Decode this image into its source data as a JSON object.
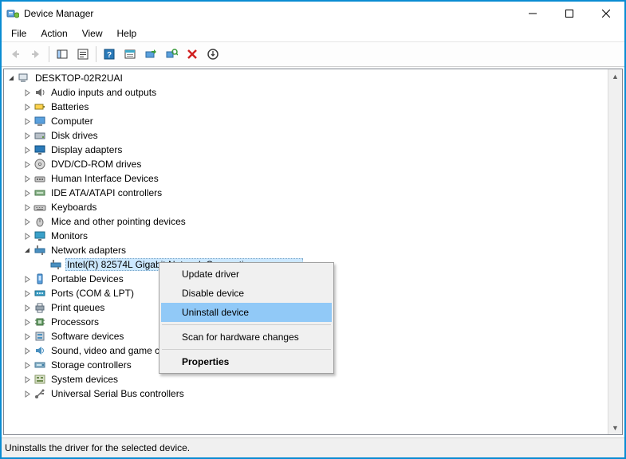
{
  "window": {
    "title": "Device Manager"
  },
  "menubar": {
    "file": "File",
    "action": "Action",
    "view": "View",
    "help": "Help"
  },
  "toolbar": {
    "back": "Back",
    "forward": "Forward",
    "show_hide_console": "Show/Hide Console Tree",
    "properties": "Properties",
    "help": "Help",
    "show_hidden": "Show hidden devices",
    "update_driver": "Update device driver",
    "scan_hardware": "Scan for hardware changes",
    "uninstall": "Uninstall device",
    "add_legacy": "Add legacy hardware"
  },
  "tree": {
    "root": {
      "label": "DESKTOP-02R2UAI",
      "expanded": true
    },
    "categories": [
      {
        "id": "audio",
        "label": "Audio inputs and outputs",
        "icon": "audio-icon",
        "expanded": false
      },
      {
        "id": "batteries",
        "label": "Batteries",
        "icon": "battery-icon",
        "expanded": false
      },
      {
        "id": "computer",
        "label": "Computer",
        "icon": "computer-icon",
        "expanded": false
      },
      {
        "id": "disk",
        "label": "Disk drives",
        "icon": "disk-icon",
        "expanded": false
      },
      {
        "id": "display",
        "label": "Display adapters",
        "icon": "display-icon",
        "expanded": false
      },
      {
        "id": "dvd",
        "label": "DVD/CD-ROM drives",
        "icon": "dvd-icon",
        "expanded": false
      },
      {
        "id": "hid",
        "label": "Human Interface Devices",
        "icon": "hid-icon",
        "expanded": false
      },
      {
        "id": "ide",
        "label": "IDE ATA/ATAPI controllers",
        "icon": "ide-icon",
        "expanded": false
      },
      {
        "id": "keyboards",
        "label": "Keyboards",
        "icon": "keyboard-icon",
        "expanded": false
      },
      {
        "id": "mice",
        "label": "Mice and other pointing devices",
        "icon": "mouse-icon",
        "expanded": false
      },
      {
        "id": "monitors",
        "label": "Monitors",
        "icon": "monitor-icon",
        "expanded": false
      },
      {
        "id": "network",
        "label": "Network adapters",
        "icon": "network-icon",
        "expanded": true,
        "children": [
          {
            "id": "nic0",
            "label": "Intel(R) 82574L Gigabit Network Connection",
            "icon": "network-icon",
            "selected": true
          }
        ]
      },
      {
        "id": "portable",
        "label": "Portable Devices",
        "icon": "portable-icon",
        "expanded": false
      },
      {
        "id": "ports",
        "label": "Ports (COM & LPT)",
        "icon": "port-icon",
        "expanded": false
      },
      {
        "id": "print",
        "label": "Print queues",
        "icon": "printer-icon",
        "expanded": false
      },
      {
        "id": "cpu",
        "label": "Processors",
        "icon": "cpu-icon",
        "expanded": false
      },
      {
        "id": "software",
        "label": "Software devices",
        "icon": "software-icon",
        "expanded": false
      },
      {
        "id": "sound",
        "label": "Sound, video and game controllers",
        "icon": "sound-icon",
        "expanded": false
      },
      {
        "id": "storage",
        "label": "Storage controllers",
        "icon": "storage-icon",
        "expanded": false
      },
      {
        "id": "system",
        "label": "System devices",
        "icon": "system-icon",
        "expanded": false
      },
      {
        "id": "usb",
        "label": "Universal Serial Bus controllers",
        "icon": "usb-icon",
        "expanded": false
      }
    ]
  },
  "context_menu": {
    "update_driver": "Update driver",
    "disable_device": "Disable device",
    "uninstall_device": "Uninstall device",
    "scan": "Scan for hardware changes",
    "properties": "Properties",
    "highlighted": "uninstall_device"
  },
  "statusbar": {
    "text": "Uninstalls the driver for the selected device."
  }
}
